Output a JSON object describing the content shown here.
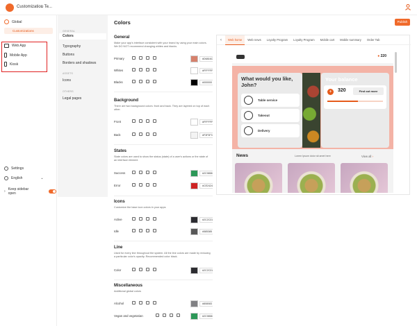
{
  "topbar": {
    "org_name": "Customization Te..."
  },
  "sidebar": {
    "global_label": "Global",
    "customizations_label": "Customizations",
    "apps": [
      {
        "label": "Web App"
      },
      {
        "label": "Mobile App"
      },
      {
        "label": "Kiosk"
      }
    ],
    "settings_label": "Settings",
    "language_label": "English",
    "keep_sidebar_label": "Keep sidebar open"
  },
  "subnav": {
    "general_section": "GENERAL",
    "items_general": [
      "Colors",
      "Typography",
      "Buttons",
      "Borders and shadows"
    ],
    "assets_section": "ASSETS",
    "items_assets": [
      "Icons"
    ],
    "other_section": "OTHERS",
    "items_other": [
      "Legal pages"
    ]
  },
  "main": {
    "title": "Colors",
    "publish_label": "Publish",
    "sections": [
      {
        "title": "General",
        "desc": "Make your app's interface consistent with your brand by using your main colors. We DO NOT recommend changing whites and blacks.",
        "rows": [
          {
            "label": "Primary",
            "hex": "#D6816C",
            "color": "#D6816C"
          },
          {
            "label": "Whites",
            "hex": "#FFFFFF",
            "color": "#FFFFFF"
          },
          {
            "label": "Blacks",
            "hex": "#000000",
            "color": "#000000"
          }
        ]
      },
      {
        "title": "Background",
        "desc": "There are two background colors: front and back. They are layered on top of each other.",
        "rows": [
          {
            "label": "Front",
            "hex": "#FFFFFF",
            "color": "#FFFFFF"
          },
          {
            "label": "Back",
            "hex": "#F3F3F3",
            "color": "#F3F3F3"
          }
        ]
      },
      {
        "title": "States",
        "desc": "State colors are used to show the status (state) of a user's actions or the state of an interface element",
        "rows": [
          {
            "label": "Success",
            "hex": "#2C9858",
            "color": "#2C9858"
          },
          {
            "label": "Error",
            "hex": "#CE2424",
            "color": "#CE2424"
          }
        ]
      },
      {
        "title": "Icons",
        "desc": "Customize the base icon colors in your apps",
        "rows": [
          {
            "label": "Active",
            "hex": "#2C2C31",
            "color": "#2C2C31"
          },
          {
            "label": "Idle",
            "hex": "#585385",
            "color": "#585858"
          }
        ]
      },
      {
        "title": "Line",
        "desc": "Used for every line throughout the system. All the line colors are made by reducing a particular color's opacity. Recommended color black.",
        "rows": [
          {
            "label": "Color",
            "hex": "#2C2C31",
            "color": "#2C2C31"
          }
        ]
      },
      {
        "title": "Miscellaneous",
        "desc": "Additional global colors",
        "rows": [
          {
            "label": "Alcohol",
            "hex": "#808083",
            "color": "#808083"
          },
          {
            "label": "Vegan and vegetarian",
            "hex": "#2C9858",
            "color": "#2C9858"
          }
        ]
      }
    ]
  },
  "preview": {
    "tabs": [
      "Web home",
      "Web news",
      "Loyalty Program",
      "Loyalty Program",
      "Mobile cart",
      "Mobile summary",
      "Order Tab"
    ],
    "points": "220",
    "question": "What would you like, John?",
    "options": [
      "Table service",
      "Takeout",
      "Delivery"
    ],
    "balance_title": "Your balance",
    "balance_value": "320",
    "find_more": "Find out more",
    "balance_progress": 0.55,
    "news_title": "News",
    "news_sub": "Lorem Ipsum dolor sit amet here",
    "view_all": "View all"
  }
}
